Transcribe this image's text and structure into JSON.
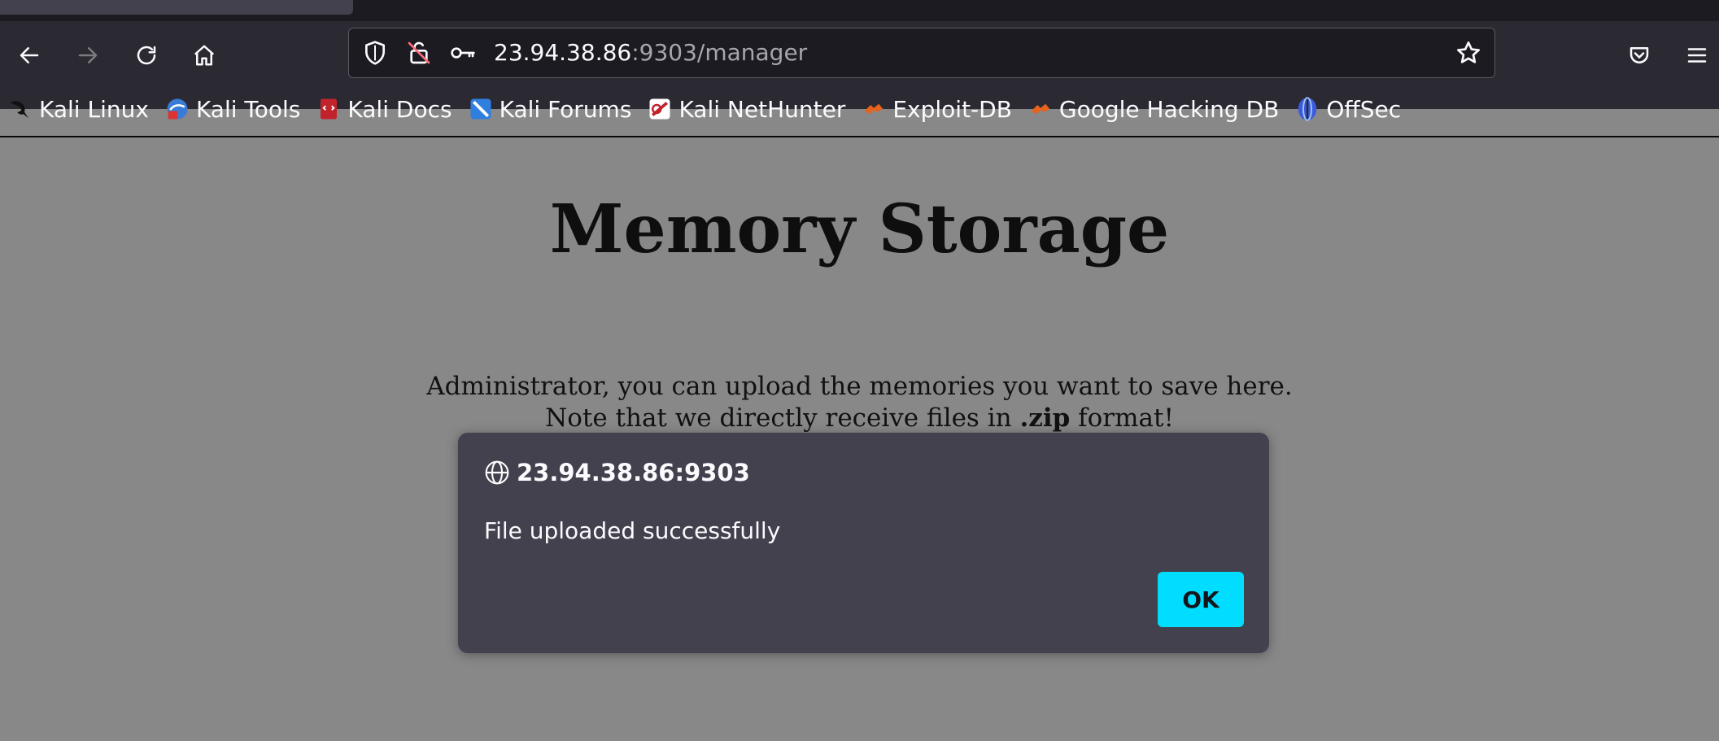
{
  "browser": {
    "url_host": "23.94.38.86",
    "url_rest": ":9303/manager",
    "bookmarks": [
      {
        "label": "Kali Linux",
        "icon": "kali-dragon-icon"
      },
      {
        "label": "Kali Tools",
        "icon": "kali-tools-icon"
      },
      {
        "label": "Kali Docs",
        "icon": "kali-docs-icon"
      },
      {
        "label": "Kali Forums",
        "icon": "kali-forums-icon"
      },
      {
        "label": "Kali NetHunter",
        "icon": "kali-nethunter-icon"
      },
      {
        "label": "Exploit-DB",
        "icon": "exploit-db-icon"
      },
      {
        "label": "Google Hacking DB",
        "icon": "ghdb-icon"
      },
      {
        "label": "OffSec",
        "icon": "offsec-icon"
      }
    ]
  },
  "page": {
    "title": "Memory Storage",
    "desc_line1": "Administrator, you can upload the memories you want to save here.",
    "desc_line2_pre": "Note that we directly receive files in ",
    "desc_line2_bold": ".zip",
    "desc_line2_post": " format!"
  },
  "dialog": {
    "origin": "23.94.38.86:9303",
    "message": "File uploaded successfully",
    "ok_label": "OK"
  },
  "colors": {
    "accent": "#00ddff",
    "dialog_bg": "#42414d",
    "page_overlay_bg": "#888889"
  }
}
